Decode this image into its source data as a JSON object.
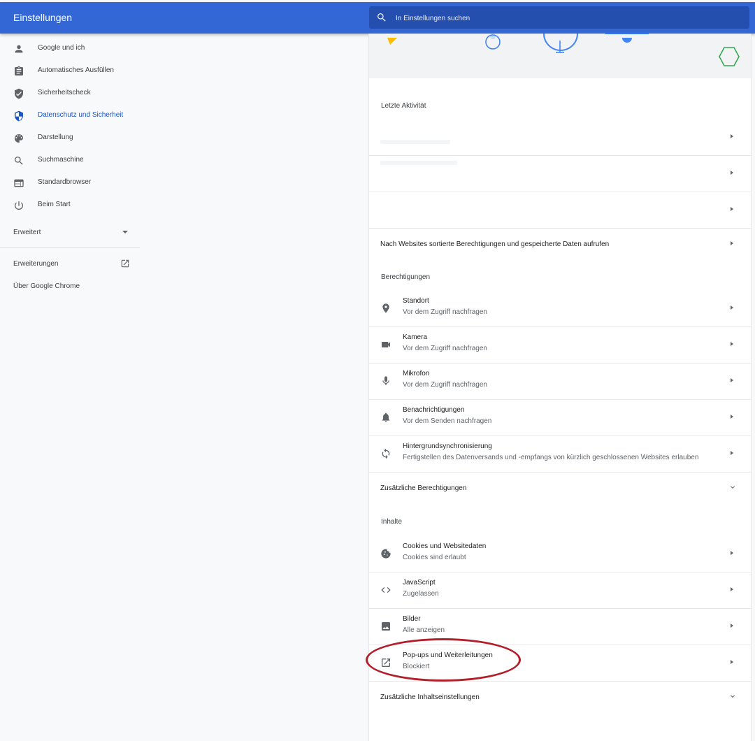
{
  "header": {
    "title": "Einstellungen",
    "search_placeholder": "In Einstellungen suchen"
  },
  "sidebar": {
    "items": [
      {
        "label": "Google und ich",
        "icon": "person-icon"
      },
      {
        "label": "Automatisches Ausfüllen",
        "icon": "clipboard-icon"
      },
      {
        "label": "Sicherheitscheck",
        "icon": "shield-check-icon"
      },
      {
        "label": "Datenschutz und Sicherheit",
        "icon": "shield-icon",
        "active": true
      },
      {
        "label": "Darstellung",
        "icon": "palette-icon"
      },
      {
        "label": "Suchmaschine",
        "icon": "search-icon"
      },
      {
        "label": "Standardbrowser",
        "icon": "browser-icon"
      },
      {
        "label": "Beim Start",
        "icon": "power-icon"
      }
    ],
    "advanced_label": "Erweitert",
    "extensions_label": "Erweiterungen",
    "about_label": "Über Google Chrome"
  },
  "main": {
    "recent_activity_title": "Letzte Aktivität",
    "site_data_link": "Nach Websites sortierte Berechtigungen und gespeicherte Daten aufrufen",
    "permissions_title": "Berechtigungen",
    "permissions": [
      {
        "title": "Standort",
        "subtitle": "Vor dem Zugriff nachfragen",
        "icon": "location-icon"
      },
      {
        "title": "Kamera",
        "subtitle": "Vor dem Zugriff nachfragen",
        "icon": "camera-icon"
      },
      {
        "title": "Mikrofon",
        "subtitle": "Vor dem Zugriff nachfragen",
        "icon": "microphone-icon"
      },
      {
        "title": "Benachrichtigungen",
        "subtitle": "Vor dem Senden nachfragen",
        "icon": "bell-icon"
      },
      {
        "title": "Hintergrundsynchronisierung",
        "subtitle": "Fertigstellen des Datenversands und -empfangs von kürzlich geschlossenen Websites erlauben",
        "icon": "sync-icon"
      }
    ],
    "additional_permissions": "Zusätzliche Berechtigungen",
    "content_title": "Inhalte",
    "content": [
      {
        "title": "Cookies und Websitedaten",
        "subtitle": "Cookies sind erlaubt",
        "icon": "cookie-icon"
      },
      {
        "title": "JavaScript",
        "subtitle": "Zugelassen",
        "icon": "code-icon"
      },
      {
        "title": "Bilder",
        "subtitle": "Alle anzeigen",
        "icon": "image-icon"
      },
      {
        "title": "Pop-ups und Weiterleitungen",
        "subtitle": "Blockiert",
        "icon": "open-in-new-icon"
      }
    ],
    "additional_content": "Zusätzliche Inhaltseinstellungen"
  },
  "colors": {
    "header_blue": "#3367d6",
    "active_blue": "#1a56c4",
    "highlight_red": "#b21f2b"
  }
}
